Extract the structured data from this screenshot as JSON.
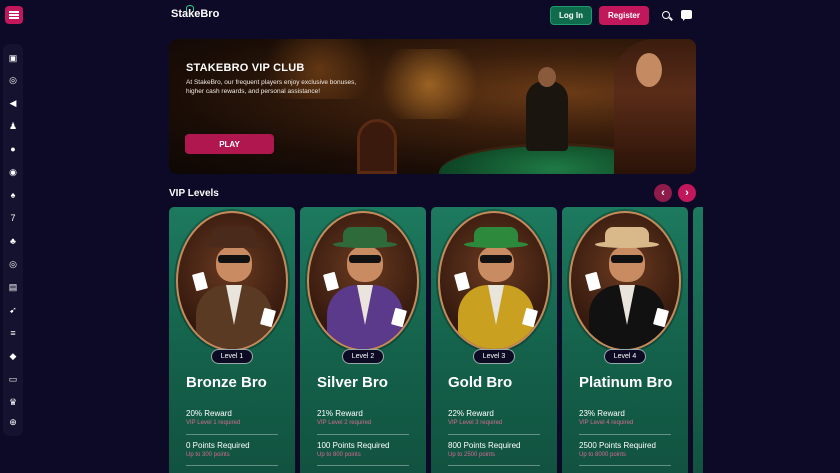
{
  "header": {
    "logo_text": "StakeBro",
    "login_label": "Log In",
    "register_label": "Register",
    "search_icon": "search-icon",
    "chat_icon": "chat-icon"
  },
  "sidebar": {
    "items": [
      {
        "icon": "slots-icon",
        "glyph": "▣"
      },
      {
        "icon": "casino-chip-icon",
        "glyph": "◎"
      },
      {
        "icon": "megaphone-icon",
        "glyph": "◀"
      },
      {
        "icon": "chess-pawn-icon",
        "glyph": "♟"
      },
      {
        "icon": "poker-chip-icon",
        "glyph": "●"
      },
      {
        "icon": "roulette-icon",
        "glyph": "◉"
      },
      {
        "icon": "dealer-icon",
        "glyph": "♠"
      },
      {
        "icon": "seven-icon",
        "glyph": "7"
      },
      {
        "icon": "cards-icon",
        "glyph": "♣"
      },
      {
        "icon": "target-icon",
        "glyph": "◎"
      },
      {
        "icon": "lottery-icon",
        "glyph": "▤"
      },
      {
        "icon": "rocket-icon",
        "glyph": "➹"
      },
      {
        "icon": "coin-stack-icon",
        "glyph": "≡"
      },
      {
        "icon": "cube-icon",
        "glyph": "◆"
      },
      {
        "icon": "ticket-icon",
        "glyph": "▭"
      },
      {
        "icon": "trophy-icon",
        "glyph": "♛"
      },
      {
        "icon": "globe-icon",
        "glyph": "⊕"
      }
    ]
  },
  "hero": {
    "title": "STAKEBRO VIP CLUB",
    "description": "At StakeBro, our frequent players enjoy exclusive bonuses, higher cash rewards, and personal assistance!",
    "play_label": "PLAY"
  },
  "vip": {
    "section_title": "VIP Levels",
    "prev_glyph": "‹",
    "next_glyph": "›",
    "levels": [
      {
        "badge": "Level 1",
        "name": "Bronze Bro",
        "reward": "20% Reward",
        "reward_sub": "VIP Level 1 required",
        "points": "0 Points Required",
        "points_sub": "Up to 300 points",
        "hat_color": "#4a2a1a",
        "body_color": "#5a3a22"
      },
      {
        "badge": "Level 2",
        "name": "Silver Bro",
        "reward": "21% Reward",
        "reward_sub": "VIP Level 2 required",
        "points": "100 Points Required",
        "points_sub": "Up to 800 points",
        "hat_color": "#2f6b3a",
        "body_color": "#5b3a8c"
      },
      {
        "badge": "Level 3",
        "name": "Gold Bro",
        "reward": "22% Reward",
        "reward_sub": "VIP Level 3 required",
        "points": "800 Points Required",
        "points_sub": "Up to 2500 points",
        "hat_color": "#2d8a3c",
        "body_color": "#c9a020"
      },
      {
        "badge": "Level 4",
        "name": "Platinum Bro",
        "reward": "23% Reward",
        "reward_sub": "VIP Level 4 required",
        "points": "2500 Points Required",
        "points_sub": "Up to 8000 points",
        "hat_color": "#d9b98a",
        "body_color": "#111111"
      }
    ]
  },
  "colors": {
    "background": "#0c0a26",
    "accent_pink": "#c2185b",
    "accent_green": "#0f6b4c",
    "card_green": "#1d7a5e"
  }
}
